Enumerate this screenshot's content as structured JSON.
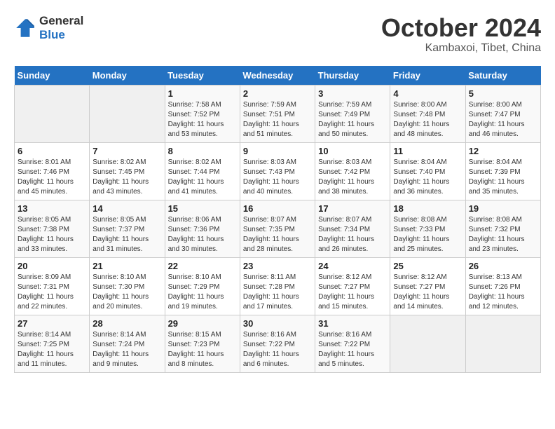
{
  "header": {
    "logo_line1": "General",
    "logo_line2": "Blue",
    "month": "October 2024",
    "location": "Kambaxoi, Tibet, China"
  },
  "weekdays": [
    "Sunday",
    "Monday",
    "Tuesday",
    "Wednesday",
    "Thursday",
    "Friday",
    "Saturday"
  ],
  "weeks": [
    [
      {
        "day": "",
        "info": ""
      },
      {
        "day": "",
        "info": ""
      },
      {
        "day": "1",
        "info": "Sunrise: 7:58 AM\nSunset: 7:52 PM\nDaylight: 11 hours and 53 minutes."
      },
      {
        "day": "2",
        "info": "Sunrise: 7:59 AM\nSunset: 7:51 PM\nDaylight: 11 hours and 51 minutes."
      },
      {
        "day": "3",
        "info": "Sunrise: 7:59 AM\nSunset: 7:49 PM\nDaylight: 11 hours and 50 minutes."
      },
      {
        "day": "4",
        "info": "Sunrise: 8:00 AM\nSunset: 7:48 PM\nDaylight: 11 hours and 48 minutes."
      },
      {
        "day": "5",
        "info": "Sunrise: 8:00 AM\nSunset: 7:47 PM\nDaylight: 11 hours and 46 minutes."
      }
    ],
    [
      {
        "day": "6",
        "info": "Sunrise: 8:01 AM\nSunset: 7:46 PM\nDaylight: 11 hours and 45 minutes."
      },
      {
        "day": "7",
        "info": "Sunrise: 8:02 AM\nSunset: 7:45 PM\nDaylight: 11 hours and 43 minutes."
      },
      {
        "day": "8",
        "info": "Sunrise: 8:02 AM\nSunset: 7:44 PM\nDaylight: 11 hours and 41 minutes."
      },
      {
        "day": "9",
        "info": "Sunrise: 8:03 AM\nSunset: 7:43 PM\nDaylight: 11 hours and 40 minutes."
      },
      {
        "day": "10",
        "info": "Sunrise: 8:03 AM\nSunset: 7:42 PM\nDaylight: 11 hours and 38 minutes."
      },
      {
        "day": "11",
        "info": "Sunrise: 8:04 AM\nSunset: 7:40 PM\nDaylight: 11 hours and 36 minutes."
      },
      {
        "day": "12",
        "info": "Sunrise: 8:04 AM\nSunset: 7:39 PM\nDaylight: 11 hours and 35 minutes."
      }
    ],
    [
      {
        "day": "13",
        "info": "Sunrise: 8:05 AM\nSunset: 7:38 PM\nDaylight: 11 hours and 33 minutes."
      },
      {
        "day": "14",
        "info": "Sunrise: 8:05 AM\nSunset: 7:37 PM\nDaylight: 11 hours and 31 minutes."
      },
      {
        "day": "15",
        "info": "Sunrise: 8:06 AM\nSunset: 7:36 PM\nDaylight: 11 hours and 30 minutes."
      },
      {
        "day": "16",
        "info": "Sunrise: 8:07 AM\nSunset: 7:35 PM\nDaylight: 11 hours and 28 minutes."
      },
      {
        "day": "17",
        "info": "Sunrise: 8:07 AM\nSunset: 7:34 PM\nDaylight: 11 hours and 26 minutes."
      },
      {
        "day": "18",
        "info": "Sunrise: 8:08 AM\nSunset: 7:33 PM\nDaylight: 11 hours and 25 minutes."
      },
      {
        "day": "19",
        "info": "Sunrise: 8:08 AM\nSunset: 7:32 PM\nDaylight: 11 hours and 23 minutes."
      }
    ],
    [
      {
        "day": "20",
        "info": "Sunrise: 8:09 AM\nSunset: 7:31 PM\nDaylight: 11 hours and 22 minutes."
      },
      {
        "day": "21",
        "info": "Sunrise: 8:10 AM\nSunset: 7:30 PM\nDaylight: 11 hours and 20 minutes."
      },
      {
        "day": "22",
        "info": "Sunrise: 8:10 AM\nSunset: 7:29 PM\nDaylight: 11 hours and 19 minutes."
      },
      {
        "day": "23",
        "info": "Sunrise: 8:11 AM\nSunset: 7:28 PM\nDaylight: 11 hours and 17 minutes."
      },
      {
        "day": "24",
        "info": "Sunrise: 8:12 AM\nSunset: 7:27 PM\nDaylight: 11 hours and 15 minutes."
      },
      {
        "day": "25",
        "info": "Sunrise: 8:12 AM\nSunset: 7:27 PM\nDaylight: 11 hours and 14 minutes."
      },
      {
        "day": "26",
        "info": "Sunrise: 8:13 AM\nSunset: 7:26 PM\nDaylight: 11 hours and 12 minutes."
      }
    ],
    [
      {
        "day": "27",
        "info": "Sunrise: 8:14 AM\nSunset: 7:25 PM\nDaylight: 11 hours and 11 minutes."
      },
      {
        "day": "28",
        "info": "Sunrise: 8:14 AM\nSunset: 7:24 PM\nDaylight: 11 hours and 9 minutes."
      },
      {
        "day": "29",
        "info": "Sunrise: 8:15 AM\nSunset: 7:23 PM\nDaylight: 11 hours and 8 minutes."
      },
      {
        "day": "30",
        "info": "Sunrise: 8:16 AM\nSunset: 7:22 PM\nDaylight: 11 hours and 6 minutes."
      },
      {
        "day": "31",
        "info": "Sunrise: 8:16 AM\nSunset: 7:22 PM\nDaylight: 11 hours and 5 minutes."
      },
      {
        "day": "",
        "info": ""
      },
      {
        "day": "",
        "info": ""
      }
    ]
  ]
}
